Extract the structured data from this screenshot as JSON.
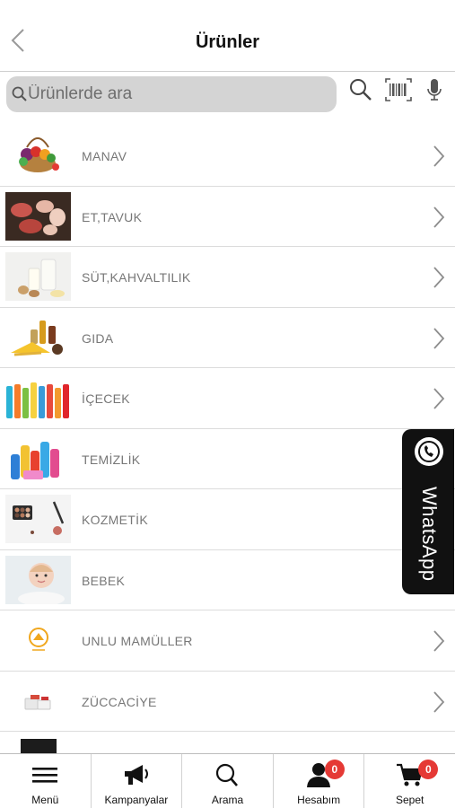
{
  "header": {
    "title": "Ürünler"
  },
  "search": {
    "placeholder": "Ürünlerde ara"
  },
  "categories": [
    {
      "label": "MANAV",
      "icon": "vegetables-basket-icon"
    },
    {
      "label": "ET,TAVUK",
      "icon": "meat-chicken-icon"
    },
    {
      "label": "SÜT,KAHVALTILIK",
      "icon": "milk-breakfast-icon"
    },
    {
      "label": "GIDA",
      "icon": "food-groceries-icon"
    },
    {
      "label": "İÇECEK",
      "icon": "drinks-bottles-icon"
    },
    {
      "label": "TEMİZLİK",
      "icon": "cleaning-products-icon"
    },
    {
      "label": "KOZMETİK",
      "icon": "cosmetics-palette-icon"
    },
    {
      "label": "BEBEK",
      "icon": "baby-icon"
    },
    {
      "label": "UNLU MAMÜLLER",
      "icon": "bakery-logo-icon"
    },
    {
      "label": "ZÜCCACİYE",
      "icon": "kitchenware-icon"
    }
  ],
  "whatsapp": {
    "label": "WhatsApp"
  },
  "tabbar": {
    "menu": "Menü",
    "campaigns": "Kampanyalar",
    "search": "Arama",
    "account": "Hesabım",
    "account_badge": "0",
    "cart": "Sepet",
    "cart_badge": "0"
  },
  "colors": {
    "badge": "#e53935",
    "search_bg": "#d4d4d4",
    "whatsapp_bg": "#111111"
  }
}
